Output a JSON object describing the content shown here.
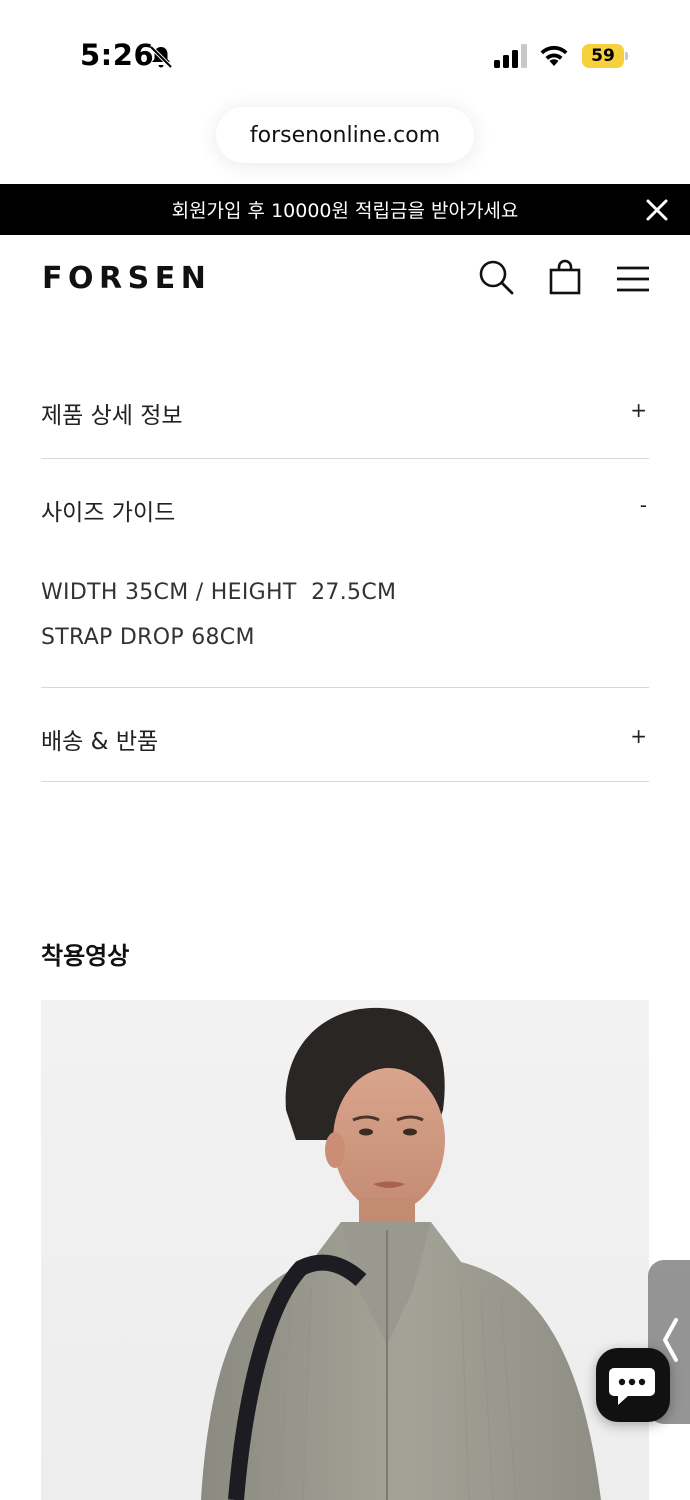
{
  "status_bar": {
    "time": "5:26",
    "battery": "59",
    "icons": [
      "bell-slash-icon",
      "cellular-signal-icon",
      "wifi-icon",
      "battery-icon"
    ],
    "battery_color": "#f7d13c"
  },
  "browser": {
    "url": "forsenonline.com"
  },
  "promo_banner": {
    "text": "회원가입 후 10000원 적립금을 받아가세요",
    "background": "#000000",
    "close_icon": "close-icon"
  },
  "header": {
    "logo": "FORSEN",
    "icons": [
      "search-icon",
      "shopping-bag-icon",
      "hamburger-menu-icon"
    ]
  },
  "accordion": {
    "items": [
      {
        "title": "제품 상세 정보",
        "toggle": "+",
        "expanded": false
      },
      {
        "title": "사이즈 가이드",
        "toggle": "-",
        "expanded": true,
        "content": [
          "WIDTH 35CM / HEIGHT  27.5CM",
          "STRAP DROP 68CM"
        ]
      },
      {
        "title": "배송 & 반품",
        "toggle": "+",
        "expanded": false
      }
    ]
  },
  "video_section": {
    "title": "착용영상"
  },
  "floating": {
    "side_tab_icon": "chevron-left-icon",
    "chat_icon": "chat-bubble-icon"
  }
}
